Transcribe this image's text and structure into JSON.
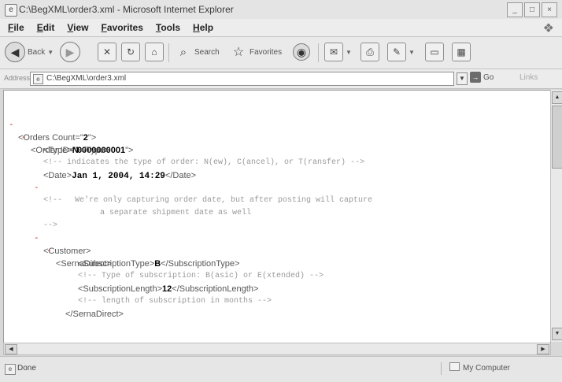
{
  "window": {
    "title": "C:\\BegXML\\order3.xml - Microsoft Internet Explorer",
    "controls": [
      "minimize-icon",
      "maximize-icon",
      "close-icon"
    ]
  },
  "menu": {
    "items": [
      "File",
      "Edit",
      "View",
      "Favorites",
      "Tools",
      "Help"
    ]
  },
  "toolbar": {
    "back_label": "Back",
    "search_label": "Search",
    "favorites_label": "Favorites",
    "icons": [
      "back-icon",
      "forward-icon",
      "stop-icon",
      "refresh-icon",
      "home-icon",
      "search-icon",
      "favorites-icon",
      "media-icon",
      "mail-icon",
      "print-icon",
      "edit-icon",
      "discuss-icon",
      "research-icon"
    ]
  },
  "address": {
    "label": "Address",
    "url": "C:\\BegXML\\order3.xml",
    "go_label": "Go",
    "links_label": "Links"
  },
  "xml": {
    "orders_open": "<Orders Count=\"",
    "orders_count": "2",
    "attr_close": "\">",
    "order_open": "<Order ID=\"",
    "order_id": "0000000001",
    "type_open": "<Type>",
    "type_value": "N",
    "type_close": "</Type>",
    "comment_type": "<!-- indicates the type of order: N(ew), C(ancel), or T(ransfer) -->",
    "date_open": "<Date>",
    "date_value": "Jan 1, 2004, 14:29",
    "date_close": "</Date>",
    "comment_open": "<!--",
    "comment_line1": "We're only capturing order date, but after posting will capture",
    "comment_line2": "a separate shipment date as well",
    "comment_close": "-->",
    "customer_open": "<Customer>",
    "serna_open": "<SernaDirect>",
    "subtype_open": "<SubscriptionType>",
    "subtype_value": "B",
    "subtype_close": "</SubscriptionType>",
    "comment_subtype": "<!-- Type of subscription: B(asic) or E(xtended) -->",
    "sublen_open": "<SubscriptionLength>",
    "sublen_value": "12",
    "sublen_close": "</SubscriptionLength>",
    "comment_sublen": "<!-- length of subscription in months -->",
    "serna_close": "</SernaDirect>",
    "toggle_minus": "-",
    "toggle_plus": "+"
  },
  "status": {
    "text": "Done",
    "zone": "My Computer"
  }
}
